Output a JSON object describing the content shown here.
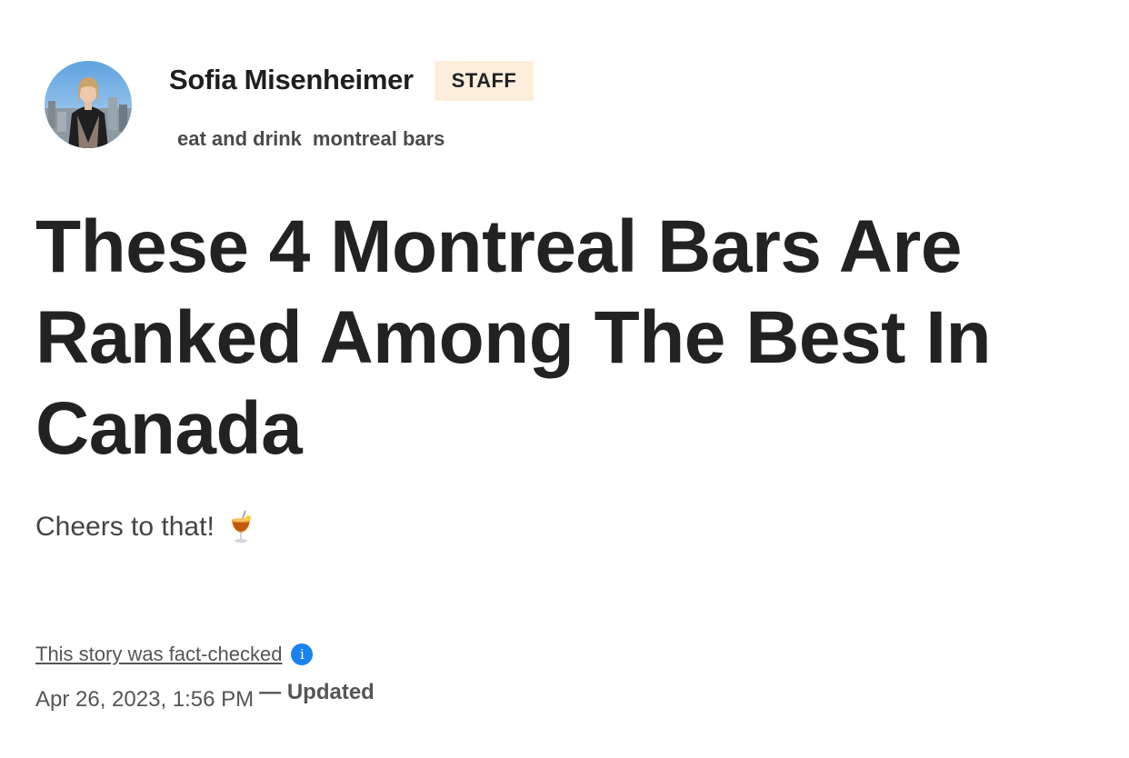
{
  "author": {
    "name": "Sofia Misenheimer",
    "badge": "STAFF"
  },
  "tags": [
    "eat and drink",
    "montreal bars"
  ],
  "article": {
    "headline": "These 4 Montreal Bars Are Ranked Among The Best In Canada",
    "subtitle": "Cheers to that!",
    "subtitle_icon": "tropical-drink-icon",
    "fact_check_label": "This story was fact-checked",
    "fact_check_icon": "info-icon",
    "date": "Apr 26, 2023, 1:56 PM",
    "updated_label": "— Updated"
  },
  "colors": {
    "badge_bg": "#fdeedb",
    "info_icon": "#1a82ef",
    "text_dark": "#222222",
    "text_muted": "#555555"
  }
}
